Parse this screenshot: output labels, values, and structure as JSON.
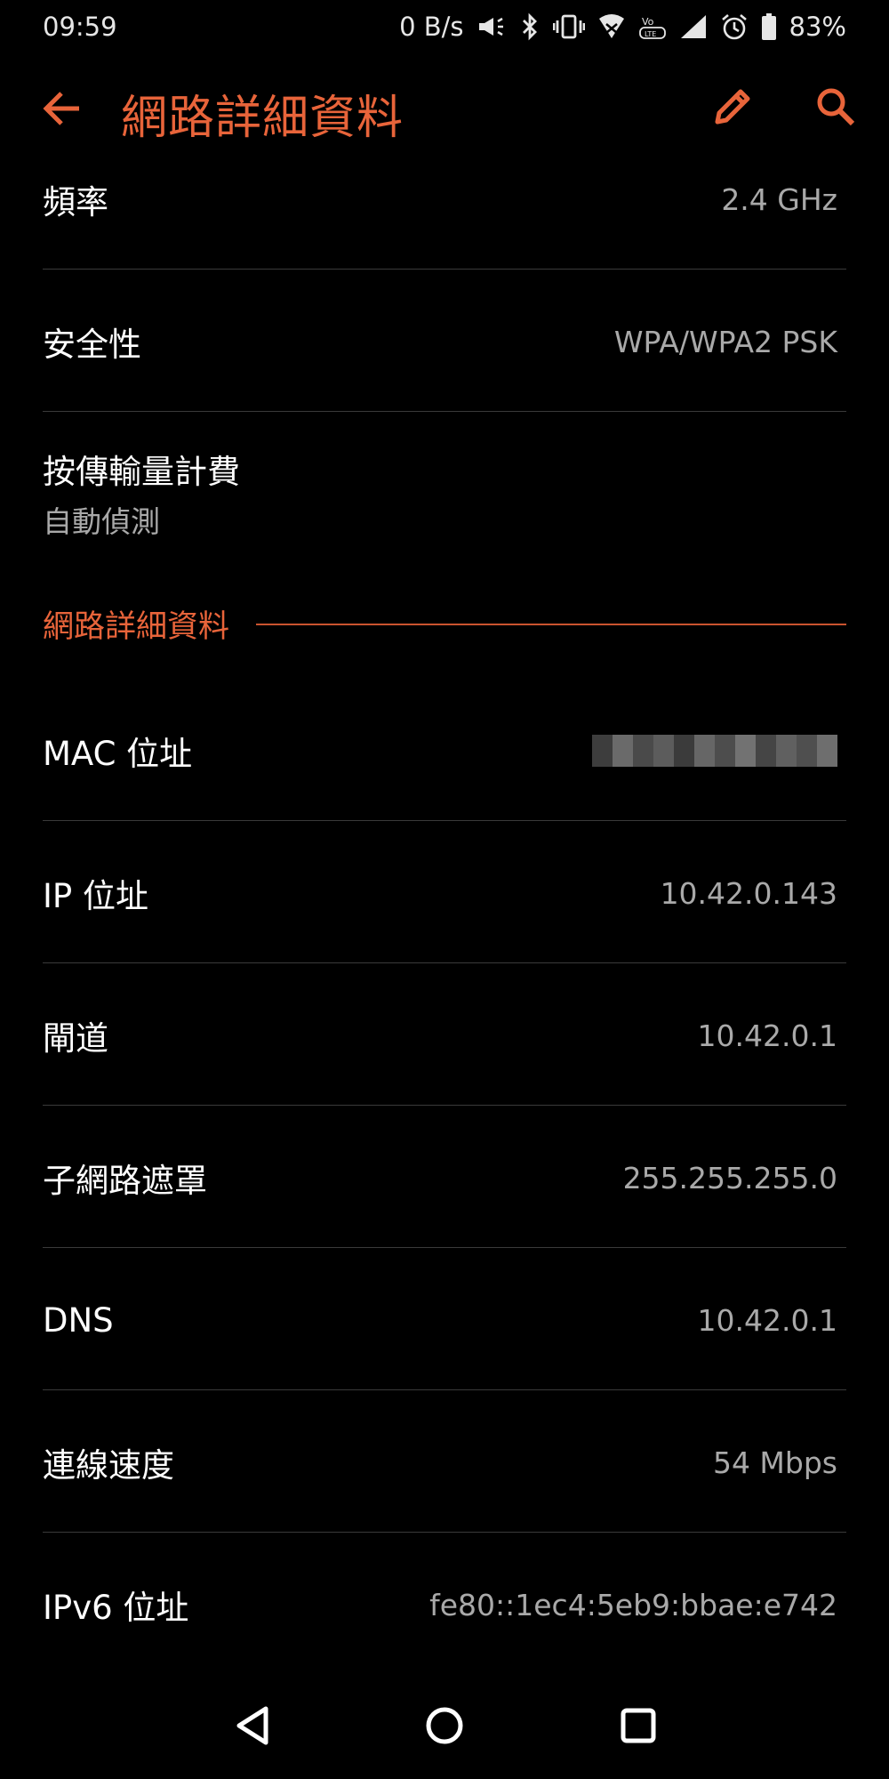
{
  "status_bar": {
    "time": "09:59",
    "net_speed": "0 B/s",
    "battery": "83%",
    "icons": [
      "megaphone-icon",
      "bluetooth-icon",
      "vibrate-icon",
      "wifi-icon",
      "volte-icon",
      "signal-icon",
      "alarm-icon",
      "battery-icon"
    ]
  },
  "app_bar": {
    "title": "網路詳細資料",
    "back_icon": "back-arrow-icon",
    "edit_icon": "pencil-icon",
    "search_icon": "search-icon"
  },
  "colors": {
    "accent": "#e8643a",
    "background": "#000000",
    "secondary_text": "#a9a9a9"
  },
  "rows_top": [
    {
      "label": "頻率",
      "value": "2.4 GHz"
    },
    {
      "label": "安全性",
      "value": "WPA/WPA2 PSK"
    }
  ],
  "metered": {
    "label": "按傳輸量計費",
    "value": "自動偵測"
  },
  "section": {
    "title": "網路詳細資料"
  },
  "details": [
    {
      "label": "MAC 位址",
      "value": ""
    },
    {
      "label": "IP 位址",
      "value": "10.42.0.143"
    },
    {
      "label": "閘道",
      "value": "10.42.0.1"
    },
    {
      "label": "子網路遮罩",
      "value": "255.255.255.0"
    },
    {
      "label": "DNS",
      "value": "10.42.0.1"
    },
    {
      "label": "連線速度",
      "value": "54 Mbps"
    },
    {
      "label": "IPv6 位址",
      "value": "fe80::1ec4:5eb9:bbae:e742"
    }
  ],
  "nav_bar": {
    "back_icon": "nav-back-icon",
    "home_icon": "nav-home-icon",
    "recents_icon": "nav-recents-icon"
  }
}
